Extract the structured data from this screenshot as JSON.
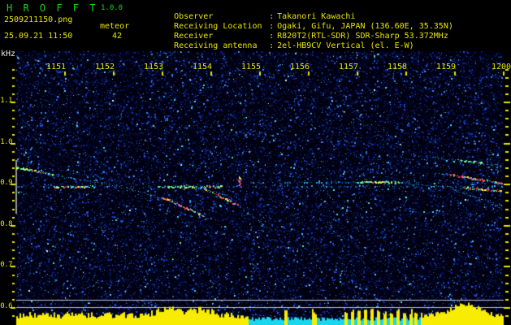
{
  "app": {
    "title": "H R O F F T",
    "version": "1.0.0",
    "filename": "2509211150.png",
    "mode": "meteor",
    "datetime": "25.09.21 11:50",
    "echo_count": "42"
  },
  "info": {
    "separator": ":",
    "rows": [
      {
        "label": "Observer",
        "value": "Takanori Kawachi"
      },
      {
        "label": "Receiving Location",
        "value": "Ogaki, Gifu, JAPAN (136.60E, 35.35N)"
      },
      {
        "label": "Receiver",
        "value": "R820T2(RTL-SDR) SDR-Sharp 53.372MHz"
      },
      {
        "label": "Receiving antenna",
        "value": "2el-HB9CV Vertical (el. E-W)"
      }
    ]
  },
  "colors": {
    "title_green": "#17d417",
    "text_yellow": "#e6e600",
    "unit_white": "#e8e8e8",
    "tick_yellow": "#e8e800",
    "plot_bg": "#000010",
    "threshold_gray": "#c0c0c8",
    "marker_gray": "#989898",
    "bar_yellow": "#f8ec00",
    "bar_cyan": "#18d8f0"
  },
  "chart_data": {
    "type": "heatmap",
    "subtype": "radio-meteor-spectrogram",
    "x_axis": {
      "label": "",
      "start_hhmm": "1150",
      "end_hhmm": "1200",
      "minutes_per_tick": 1,
      "ticks": [
        "1151",
        "1152",
        "1153",
        "1154",
        "1155",
        "1156",
        "1157",
        "1158",
        "1159",
        "1200"
      ]
    },
    "y_axis": {
      "label": "kHz",
      "ticks": [
        "1.1",
        "1.0",
        "0.9",
        "0.8",
        "0.7",
        "0.6"
      ],
      "tick_values_khz": [
        1.1,
        1.0,
        0.9,
        0.8,
        0.7,
        0.6
      ],
      "minor_step_khz": 0.02,
      "top_khz": 1.18,
      "bottom_khz": 0.58
    },
    "threshold_lines_khz": [
      0.618,
      0.6
    ],
    "left_marker": {
      "t_min": 0,
      "f_top_khz": 0.958,
      "f_bottom_khz": 0.827
    },
    "carrier_lines": [
      {
        "f_khz": 0.893,
        "t0": 0.0,
        "t1": 10.0,
        "bright_segments": [
          [
            0.7,
            1.6
          ],
          [
            2.9,
            4.2
          ]
        ]
      },
      {
        "f_khz": 0.904,
        "t0": 4.8,
        "t1": 10.0,
        "bright_segments": [
          [
            7.0,
            7.85
          ]
        ]
      }
    ],
    "trails": [
      {
        "name": "trail-a",
        "pts": [
          [
            0,
            0.938
          ],
          [
            0.7,
            0.921
          ],
          [
            1.6,
            0.906
          ],
          [
            2.4,
            0.886
          ],
          [
            3.1,
            0.861
          ],
          [
            3.85,
            0.82
          ]
        ],
        "intensity": "cyan",
        "cores": [
          {
            "t0": 0,
            "t1": 0.75,
            "palette": "bright"
          },
          {
            "t0": 3.0,
            "t1": 3.85,
            "palette": "hot"
          }
        ]
      },
      {
        "name": "trail-a2",
        "pts": [
          [
            0.35,
            0.943
          ],
          [
            2.1,
            0.908
          ]
        ],
        "intensity": "faint",
        "cores": []
      },
      {
        "name": "trail-b",
        "pts": [
          [
            3.4,
            0.899
          ],
          [
            4.2,
            0.876
          ],
          [
            4.85,
            0.821
          ],
          [
            5.15,
            0.792
          ]
        ],
        "intensity": "cyan",
        "cores": [
          {
            "t0": 3.85,
            "t1": 4.55,
            "palette": "hot"
          }
        ]
      },
      {
        "name": "head-echo-tick",
        "pts": [
          [
            4.58,
            0.917
          ],
          [
            4.58,
            0.893
          ]
        ],
        "intensity": "hot-dense",
        "cores": []
      },
      {
        "name": "trail-c",
        "pts": [
          [
            5.2,
            0.928
          ],
          [
            5.9,
            0.913
          ]
        ],
        "intensity": "faint",
        "cores": []
      },
      {
        "name": "trail-d",
        "pts": [
          [
            4.85,
            0.872
          ],
          [
            5.7,
            0.845
          ]
        ],
        "intensity": "faint",
        "cores": []
      },
      {
        "name": "trail-r1",
        "pts": [
          [
            8.5,
            0.9645
          ],
          [
            10,
            0.9425
          ]
        ],
        "intensity": "cyan",
        "cores": [
          {
            "t0": 9.05,
            "t1": 9.55,
            "palette": "bright"
          }
        ]
      },
      {
        "name": "trail-r2",
        "pts": [
          [
            8.6,
            0.926
          ],
          [
            10,
            0.899
          ]
        ],
        "intensity": "cyan",
        "cores": [
          {
            "t0": 8.9,
            "t1": 10,
            "palette": "hot"
          }
        ]
      },
      {
        "name": "trail-r3",
        "pts": [
          [
            8.05,
            0.9
          ],
          [
            10,
            0.88
          ]
        ],
        "intensity": "cyan",
        "cores": [
          {
            "t0": 9.1,
            "t1": 10,
            "palette": "hot"
          }
        ]
      },
      {
        "name": "trail-r4",
        "pts": [
          [
            8.95,
            0.886
          ],
          [
            10,
            0.844
          ]
        ],
        "intensity": "cyan",
        "cores": []
      },
      {
        "name": "trail-r5",
        "pts": [
          [
            9.4,
            0.872
          ],
          [
            10,
            0.838
          ]
        ],
        "intensity": "faint",
        "cores": []
      }
    ],
    "level_bars": {
      "regions": [
        {
          "t0": 0,
          "t1": 4.75,
          "color": "yellow",
          "h_min": 8,
          "h_max": 16,
          "peaks": [
            [
              3.1,
              8
            ],
            [
              3.8,
              7
            ]
          ]
        },
        {
          "t0": 4.75,
          "t1": 8.28,
          "color": "cyan",
          "h_min": 5,
          "h_max": 10,
          "peaks": []
        },
        {
          "t0": 8.28,
          "t1": 10,
          "color": "yellow",
          "h_min": 9,
          "h_max": 15,
          "peaks": [
            [
              9.0,
              6
            ],
            [
              9.3,
              11
            ]
          ]
        }
      ],
      "spikes_t": [
        5.52,
        6.1,
        6.75,
        6.88,
        7.01,
        7.15,
        7.28,
        7.41,
        7.55,
        7.68,
        7.81,
        7.95,
        8.08,
        8.18
      ]
    }
  }
}
